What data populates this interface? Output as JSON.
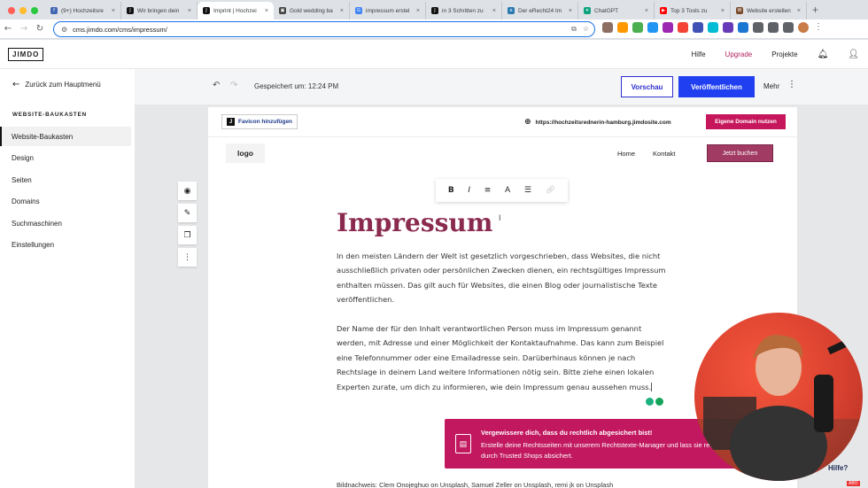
{
  "browser": {
    "tabs": [
      {
        "label": "(9+) Hochzeitsre",
        "fav_color": "#4267b2",
        "fav_glyph": "f"
      },
      {
        "label": "Wir bringen dein",
        "fav_color": "#111111",
        "fav_glyph": "J"
      },
      {
        "label": "Imprint | Hochzei",
        "fav_color": "#111111",
        "fav_glyph": "J"
      },
      {
        "label": "Gold wedding ba",
        "fav_color": "#444444",
        "fav_glyph": "▣"
      },
      {
        "label": "impressum erstel",
        "fav_color": "#4285f4",
        "fav_glyph": "G"
      },
      {
        "label": "in 3 Schritten zu",
        "fav_color": "#111111",
        "fav_glyph": "J"
      },
      {
        "label": "Der eRecht24 Im",
        "fav_color": "#2a7ab0",
        "fav_glyph": "e"
      },
      {
        "label": "ChatGPT",
        "fav_color": "#10a37f",
        "fav_glyph": "✦"
      },
      {
        "label": "Top 3 Tools zu",
        "fav_color": "#ff0000",
        "fav_glyph": "▶"
      },
      {
        "label": "Website erstellen",
        "fav_color": "#7a4a2a",
        "fav_glyph": "W"
      }
    ],
    "url": "cms.jimdo.com/cms/impressum/"
  },
  "header": {
    "logo": "JIMDO",
    "help": "Hilfe",
    "upgrade": "Upgrade",
    "projects": "Projekte"
  },
  "sidebar": {
    "back": "Zurück zum Hauptmenü",
    "section_title": "WEBSITE-BAUKASTEN",
    "items": [
      {
        "label": "Website-Baukasten"
      },
      {
        "label": "Design"
      },
      {
        "label": "Seiten"
      },
      {
        "label": "Domains"
      },
      {
        "label": "Suchmaschinen"
      },
      {
        "label": "Einstellungen"
      }
    ]
  },
  "toolbar": {
    "saved": "Gespeichert um: 12:24 PM",
    "preview": "Vorschau",
    "publish": "Veröffentlichen",
    "more": "Mehr"
  },
  "site": {
    "favicon_button": "Favicon hinzufügen",
    "domain": "https://hochzeitsrednerin-hamburg.jimdosite.com",
    "own_domain_button": "Eigene Domain nutzen",
    "logo": "logo",
    "nav": [
      "Home",
      "Kontakt"
    ],
    "book_button": "Jetzt buchen"
  },
  "content": {
    "heading": "Impressum",
    "para1": "In den meisten Ländern der Welt ist gesetzlich vorgeschrieben, dass Websites, die nicht ausschließlich privaten oder persönlichen Zwecken dienen, ein rechtsgültiges Impressum enthalten müssen. Das gilt auch für Websites, die einen Blog oder journalistische Texte veröffentlichen.",
    "para2": "Der Name der für den Inhalt verantwortlichen Person muss im Impressum genannt werden, mit Adresse und einer Möglichkeit der Kontaktaufnahme. Das kann zum Beispiel eine Telefonnummer oder eine Emailadresse sein. Darüberhinaus können je nach Rechtslage in deinem Land weitere Informationen nötig sein. Bitte ziehe einen lokalen Experten zurate, um dich zu informieren, wie dein Impressum genau aussehen muss.",
    "caption": "Bildnachweis: Clem Onojeghuo on Unsplash, Samuel Zeller on Unsplash, remi jk on Unsplash"
  },
  "legal_banner": {
    "title": "Vergewissere dich, dass du rechtlich abgesichert bist!",
    "text": "Erstelle deine Rechtsseiten mit unserem Rechtstexte-Manager und lass sie rechtlich durch Trusted Shops absichert."
  },
  "overlay": {
    "help": "Hilfe?",
    "badge": "ABO"
  },
  "colors": {
    "accent": "#1f3ff0",
    "brand": "#c6175c",
    "heading": "#8a2a4e"
  }
}
